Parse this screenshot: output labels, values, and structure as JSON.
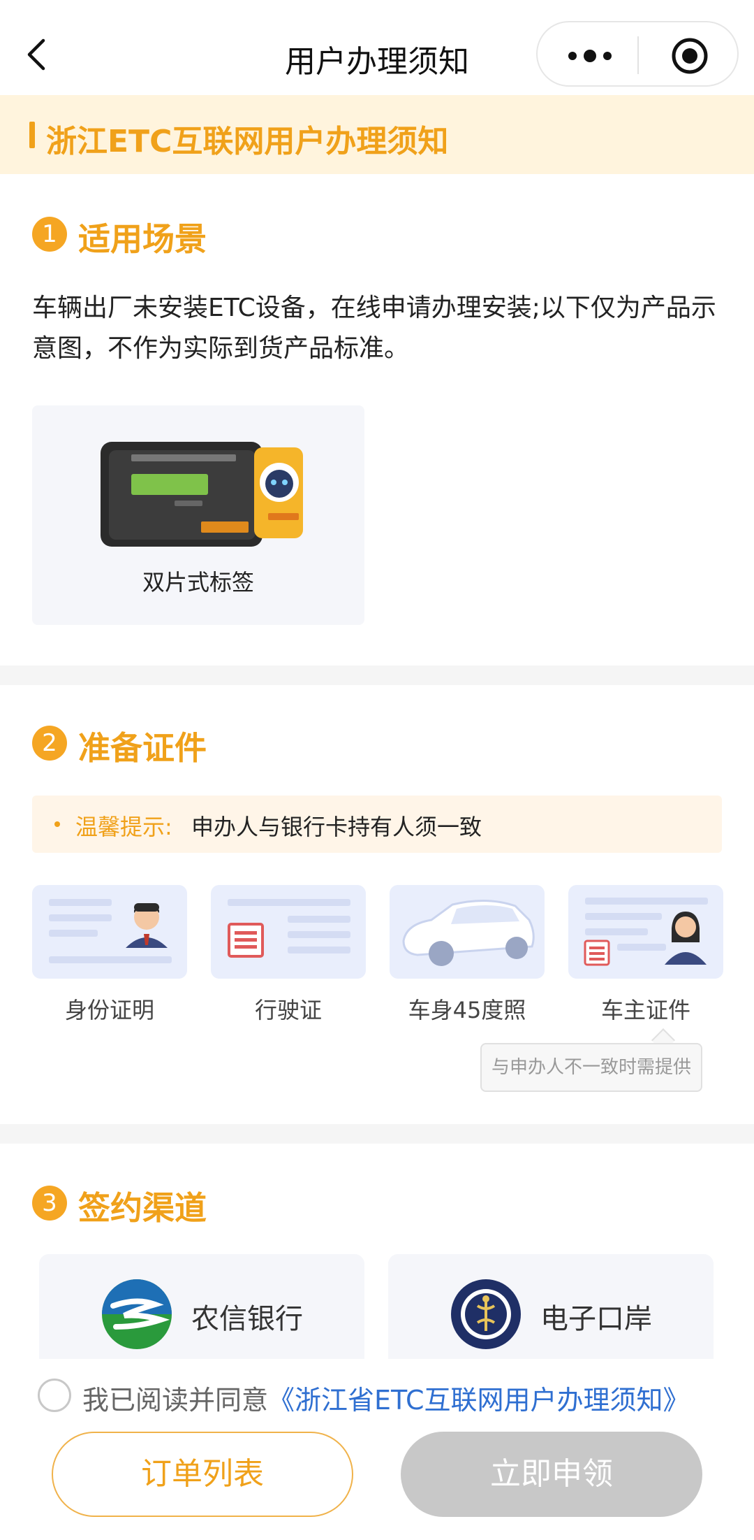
{
  "navbar": {
    "title": "用户办理须知",
    "back_icon": "chevron-left-icon",
    "more_icon": "more-dots-icon",
    "record_icon": "record-icon"
  },
  "banner": {
    "title": "浙江ETC互联网用户办理须知"
  },
  "section1": {
    "number": "1",
    "title": "适用场景",
    "description": "车辆出厂未安装ETC设备，在线申请办理安装;以下仅为产品示意图，不作为实际到货产品标准。",
    "product": {
      "caption": "双片式标签"
    }
  },
  "section2": {
    "number": "2",
    "title": "准备证件",
    "tip_label": "温馨提示:",
    "tip_text": "申办人与银行卡持有人须一致",
    "documents": [
      {
        "label": "身份证明",
        "icon": "id-card-icon"
      },
      {
        "label": "行驶证",
        "icon": "driving-license-icon"
      },
      {
        "label": "车身45度照",
        "icon": "car-photo-icon"
      },
      {
        "label": "车主证件",
        "icon": "owner-id-icon"
      }
    ],
    "tooltip": "与申办人不一致时需提供"
  },
  "section3": {
    "number": "3",
    "title": "签约渠道",
    "channels": [
      {
        "name": "农信银行",
        "icon": "rural-credit-bank-logo"
      },
      {
        "name": "电子口岸",
        "icon": "e-port-logo"
      }
    ]
  },
  "footer": {
    "agree_prefix": "我已阅读并同意",
    "agree_link": "《浙江省ETC互联网用户办理须知》",
    "orders_button": "订单列表",
    "apply_button": "立即申领"
  },
  "colors": {
    "accent": "#f0a11a",
    "link": "#2f6fd1",
    "disabled": "#c8c8c8"
  }
}
